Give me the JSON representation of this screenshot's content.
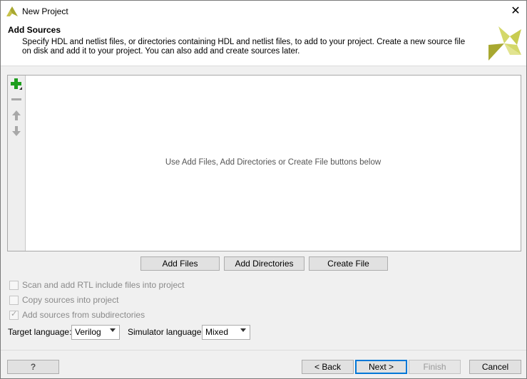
{
  "window": {
    "title": "New Project",
    "close_glyph": "✕"
  },
  "header": {
    "title": "Add Sources",
    "description": "Specify HDL and netlist files, or directories containing HDL and netlist files, to add to your project. Create a new source file on disk and add it to your project. You can also add and create sources later."
  },
  "sources": {
    "empty_message": "Use Add Files, Add Directories or Create File buttons below",
    "toolbar_icons": [
      "add-icon",
      "remove-icon",
      "move-up-icon",
      "move-down-icon"
    ]
  },
  "actions": {
    "add_files": "Add Files",
    "add_directories": "Add Directories",
    "create_file": "Create File"
  },
  "options": [
    {
      "label": "Scan and add RTL include files into project",
      "checked": false
    },
    {
      "label": "Copy sources into project",
      "checked": false
    },
    {
      "label": "Add sources from subdirectories",
      "checked": true
    }
  ],
  "language": {
    "target_label": "Target language:",
    "target_value": "Verilog",
    "simulator_label": "Simulator language:",
    "simulator_value": "Mixed"
  },
  "footer": {
    "help": "?",
    "back": "< Back",
    "next": "Next >",
    "finish": "Finish",
    "cancel": "Cancel"
  },
  "colors": {
    "add_icon": "#1e9e1e",
    "toolbar_icon": "#a8a8a8",
    "logo_light": "#d4d86a",
    "logo_dark": "#a8a830",
    "focus_border": "#0078d7"
  }
}
